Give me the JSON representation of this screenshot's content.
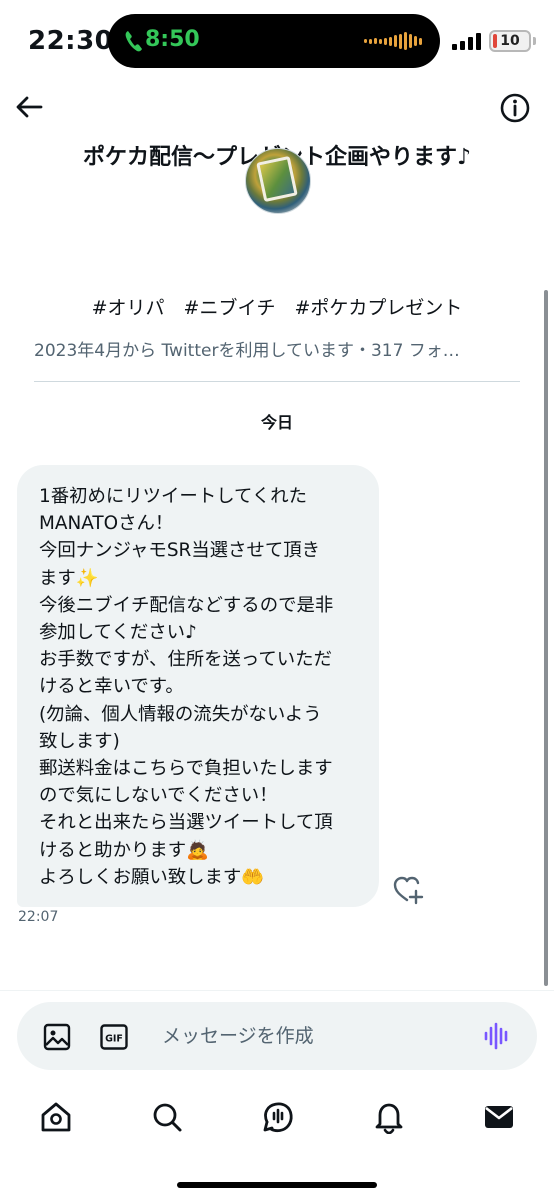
{
  "status_bar": {
    "time": "22:30",
    "call_timer": "8:50",
    "battery_level": "10",
    "call_color": "#34c759",
    "battery_color": "#e0463a"
  },
  "header": {
    "title": "ポケカ配信〜プレゼント企画やります♪",
    "back_icon": "arrow-left-icon",
    "info_icon": "info-circle-icon"
  },
  "profile": {
    "hashtags": "#オリパ　#ニブイチ　#ポケカプレゼント",
    "join_info": "2023年4月から Twitterを利用しています・317 フォ…"
  },
  "conversation": {
    "day_label": "今日",
    "messages": [
      {
        "lines": [
          "1番初めにリツイートしてくれた",
          "MANATOさん！",
          "今回ナンジャモSR当選させて頂き",
          "ます✨",
          "今後ニブイチ配信などするので是非",
          "参加してください♪",
          "お手数ですが、住所を送っていただ",
          "けると幸いです。",
          "(勿論、個人情報の流失がないよう",
          "致します)",
          "郵送料金はこちらで負担いたします",
          "ので気にしないでください！",
          "それと出来たら当選ツイートして頂",
          "けると助かります🙇",
          "よろしくお願い致します🤲"
        ],
        "time": "22:07"
      }
    ]
  },
  "composer": {
    "placeholder": "メッセージを作成",
    "accent_color": "#7856ff"
  },
  "tab_bar": {
    "items": [
      "home-icon",
      "search-icon",
      "spaces-icon",
      "notifications-icon",
      "messages-icon"
    ]
  }
}
